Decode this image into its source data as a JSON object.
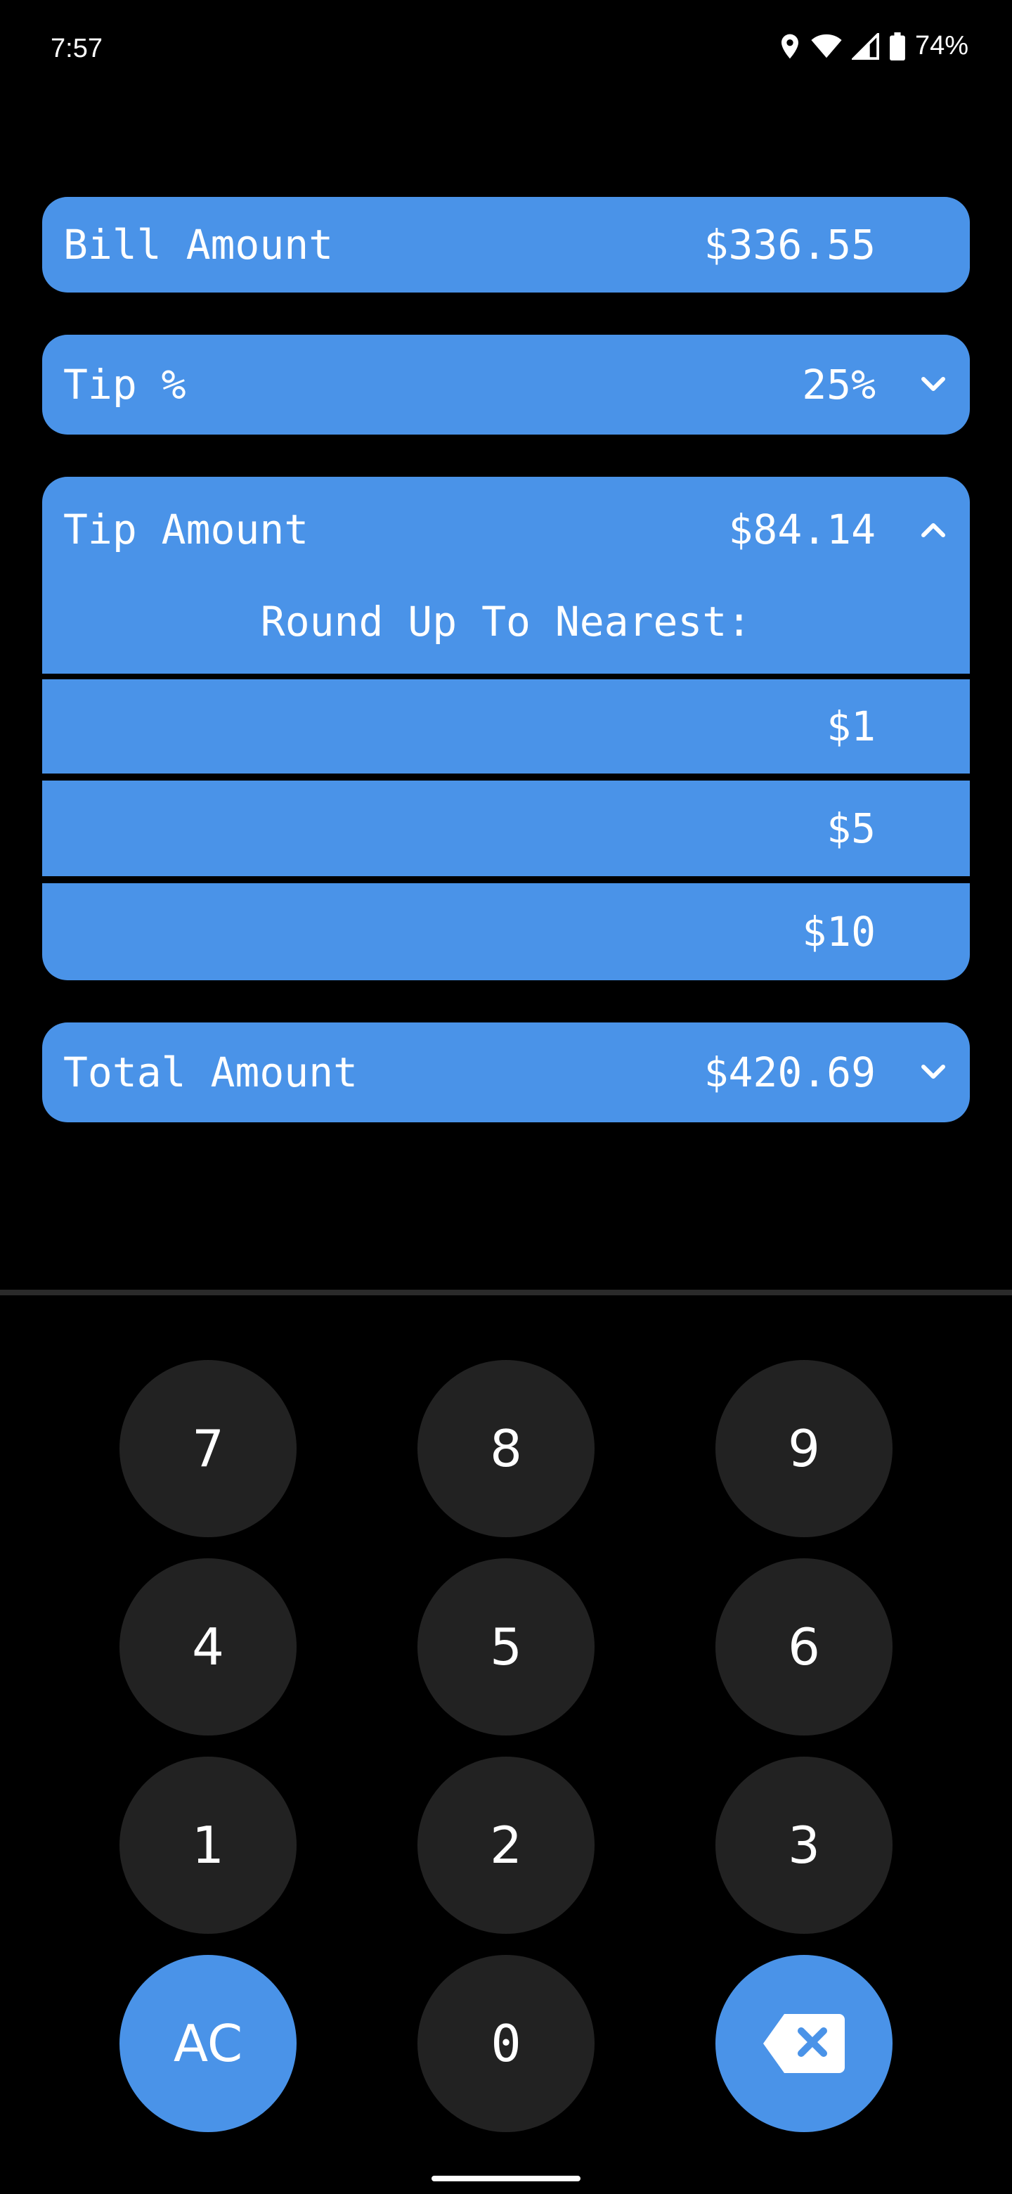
{
  "status_bar": {
    "time": "7:57",
    "battery": "74%"
  },
  "bill": {
    "label": "Bill Amount",
    "value": "$336.55"
  },
  "tip_percent": {
    "label": "Tip %",
    "value": "25%"
  },
  "tip_amount": {
    "label": "Tip Amount",
    "value": "$84.14",
    "round_title": "Round Up To Nearest:"
  },
  "round_options": [
    "$1",
    "$5",
    "$10"
  ],
  "total": {
    "label": "Total Amount",
    "value": "$420.69"
  },
  "keypad": {
    "row1": [
      "7",
      "8",
      "9"
    ],
    "row2": [
      "4",
      "5",
      "6"
    ],
    "row3": [
      "1",
      "2",
      "3"
    ],
    "clear": "AC",
    "zero": "0",
    "backspace_icon": "backspace-icon"
  },
  "colors": {
    "accent": "#4a93e8",
    "key_bg": "#222222",
    "background": "#000000"
  }
}
